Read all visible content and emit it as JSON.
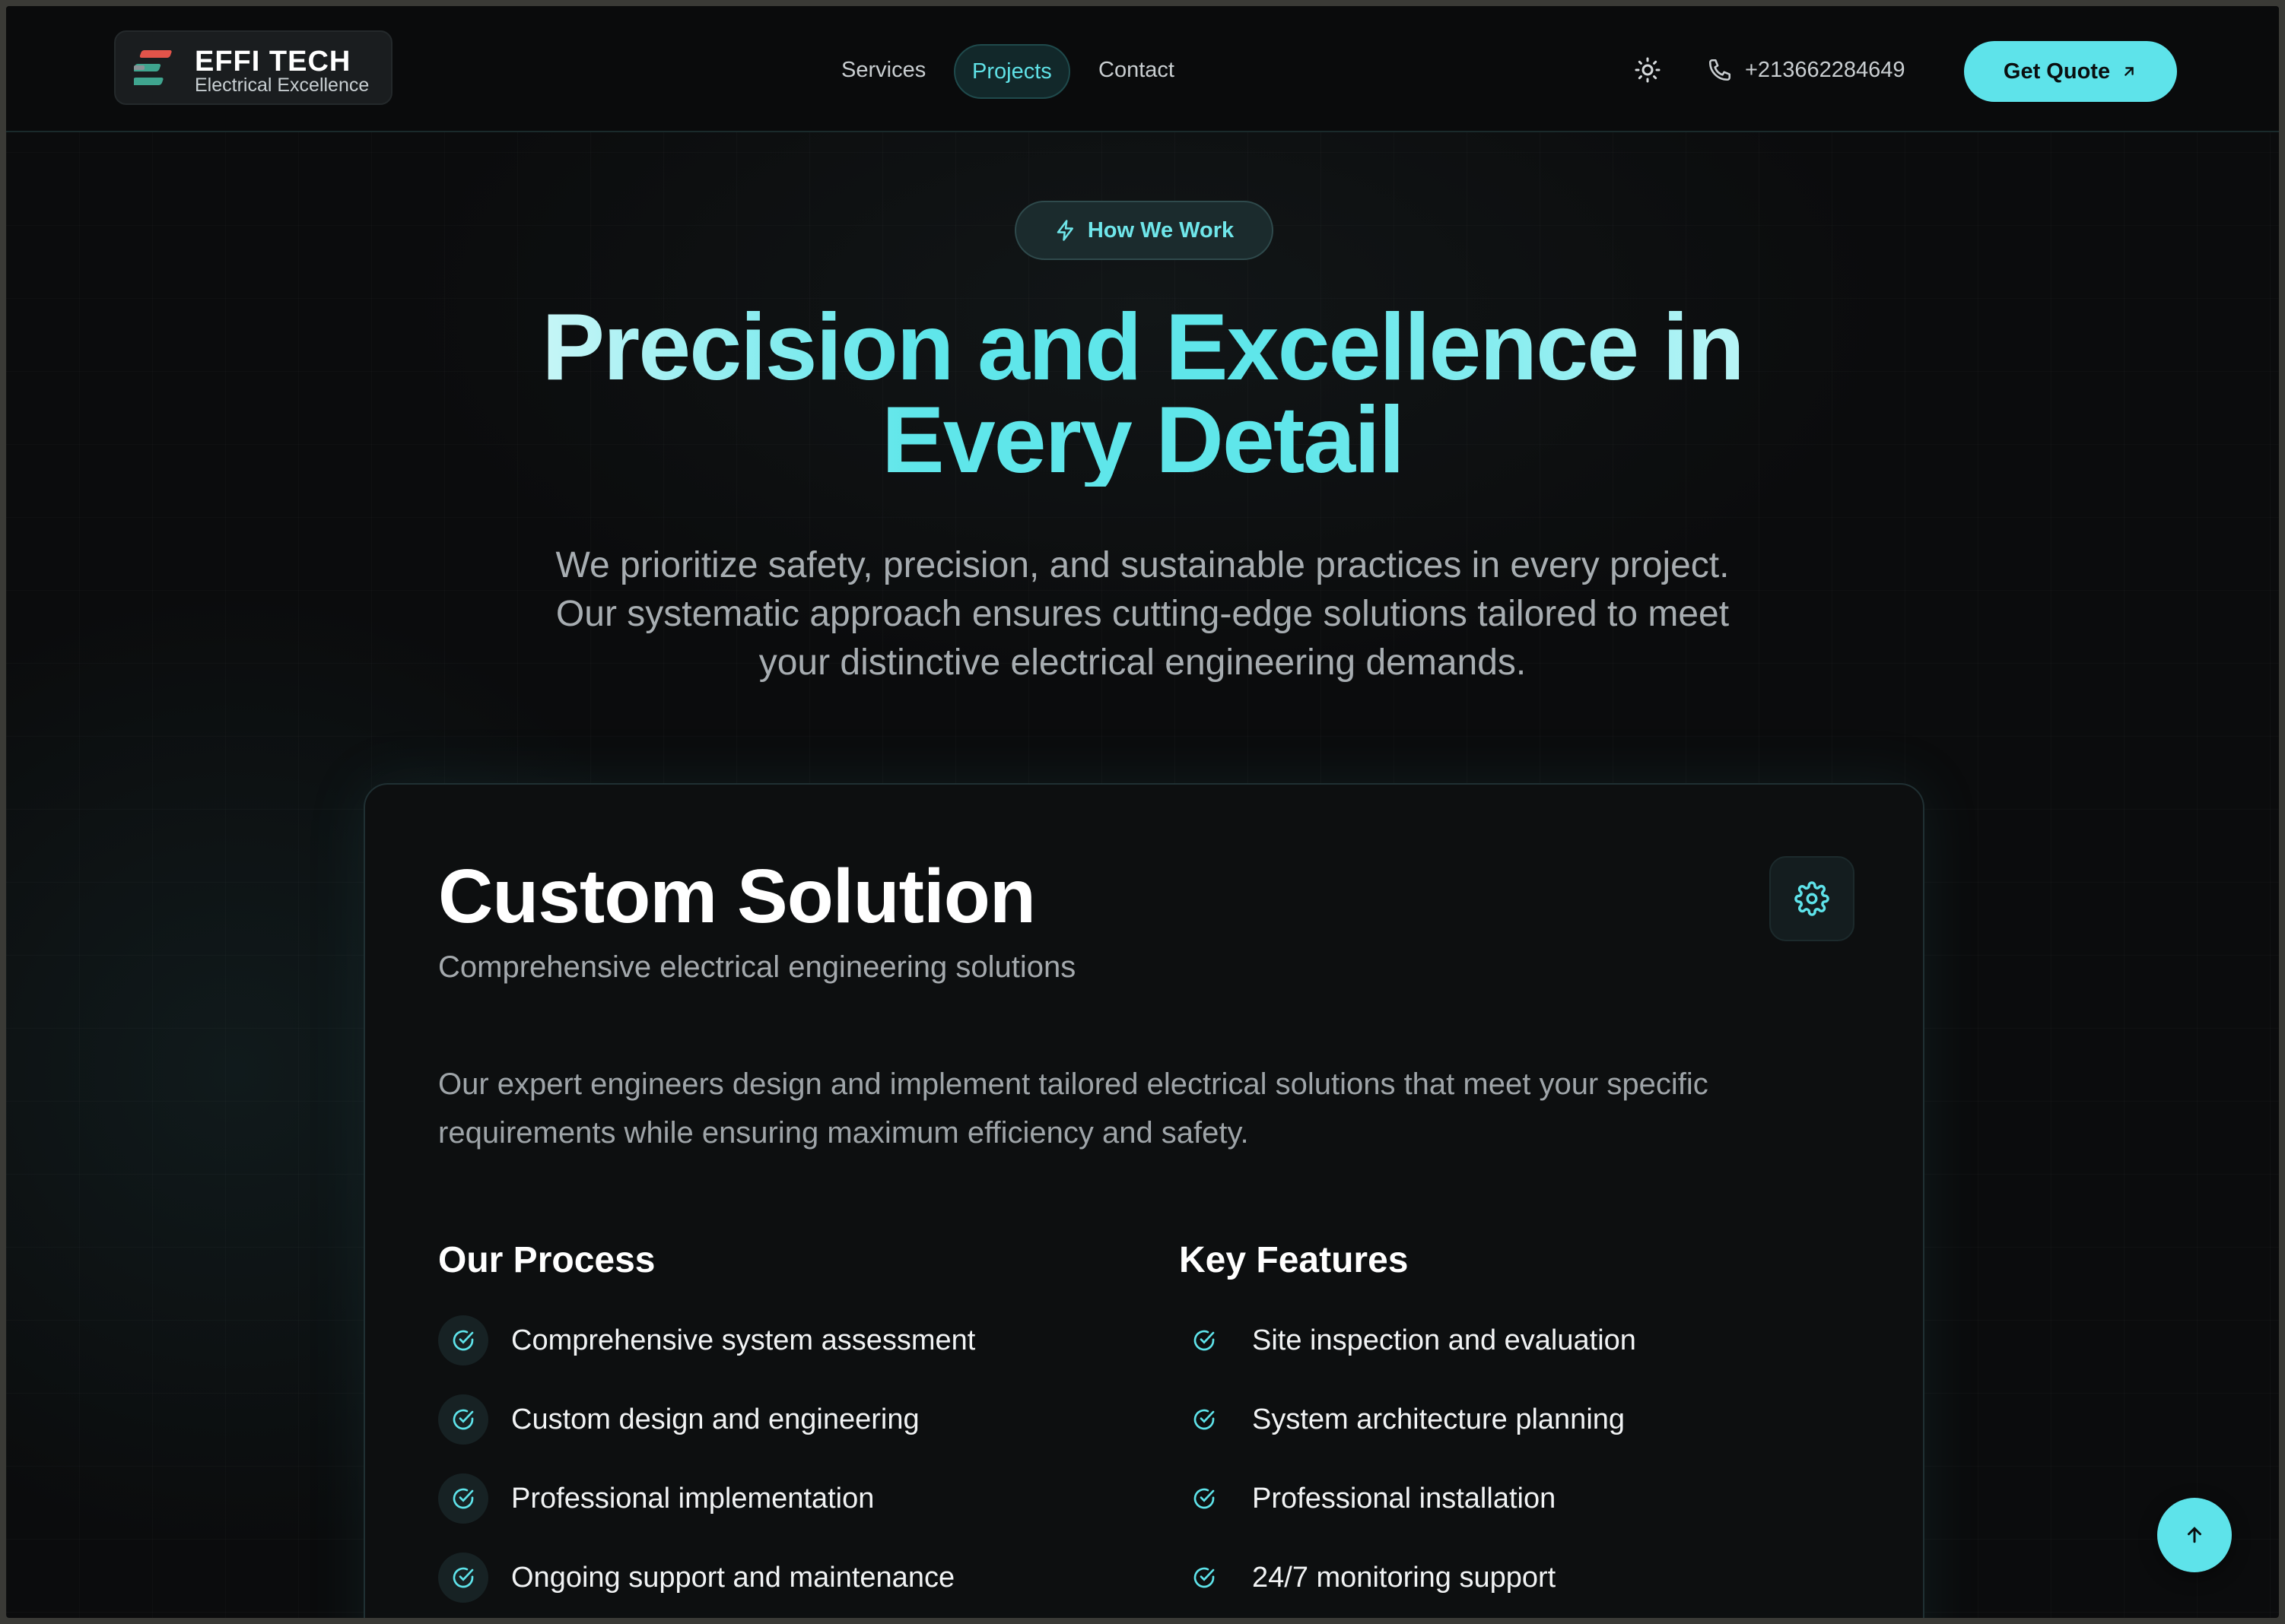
{
  "brand": {
    "name": "EFFI TECH",
    "tagline": "Electrical Excellence"
  },
  "nav": {
    "items": [
      {
        "label": "Services",
        "active": false
      },
      {
        "label": "Projects",
        "active": true
      },
      {
        "label": "Contact",
        "active": false
      }
    ],
    "phone": "+213662284649",
    "quote_label": "Get Quote"
  },
  "hero": {
    "badge": "How We Work",
    "title_line1": "Precision and Excellence in",
    "title_line2": "Every Detail",
    "description": "We prioritize safety, precision, and sustainable practices in every project. Our systematic approach ensures cutting-edge solutions tailored to meet your distinctive electrical engineering demands."
  },
  "card": {
    "title": "Custom Solution",
    "subtitle": "Comprehensive electrical engineering solutions",
    "description": "Our expert engineers design and implement tailored electrical solutions that meet your specific requirements while ensuring maximum efficiency and safety.",
    "process": {
      "title": "Our Process",
      "items": [
        "Comprehensive system assessment",
        "Custom design and engineering",
        "Professional implementation",
        "Ongoing support and maintenance"
      ]
    },
    "features": {
      "title": "Key Features",
      "items": [
        "Site inspection and evaluation",
        "System architecture planning",
        "Professional installation",
        "24/7 monitoring support"
      ]
    }
  },
  "colors": {
    "accent": "#5ee3ea",
    "background": "#0b0c0d",
    "text_muted": "#a7adb1"
  },
  "icons": [
    "lightning-icon",
    "sun-icon",
    "phone-icon",
    "arrow-up-right-icon",
    "gear-icon",
    "check-circle-icon",
    "arrow-up-icon"
  ]
}
